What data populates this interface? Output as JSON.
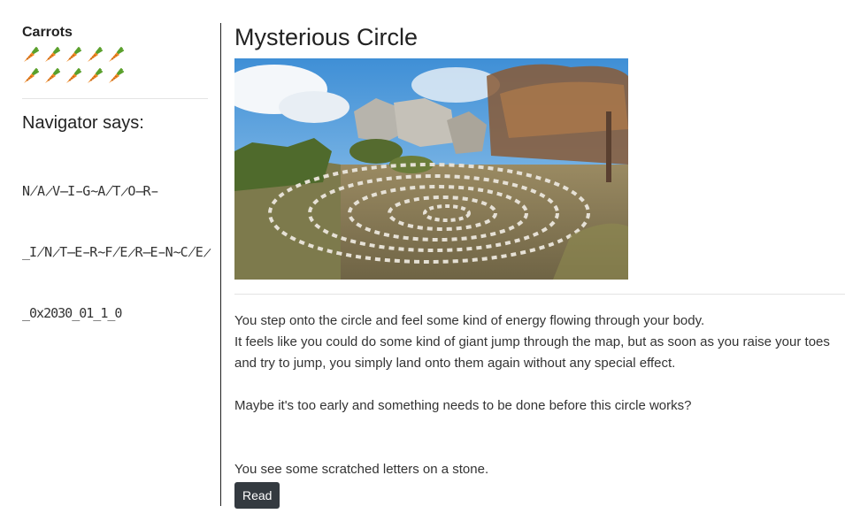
{
  "sidebar": {
    "carrots_title": "Carrots",
    "carrot_count": 10,
    "carrot_icon": "carrot-icon",
    "navigator_title": "Navigator says:",
    "navigator_lines": [
      "N̸A̷V̶I̵G̴A̸T̷O̶R̵",
      "_I̸N̷T̶E̵R̴F̸E̷R̶E̵N̴C̸E̷",
      "_0x2030_01_1_0"
    ]
  },
  "main": {
    "title": "Mysterious Circle",
    "image_alt": "stone spiral circle",
    "paragraph1_line1": "You step onto the circle and feel some kind of energy flowing through your body.",
    "paragraph1_line2": "It feels like you could do some kind of giant jump through the map, but as soon as you raise your toes and try to jump, you simply land onto them again without any special effect.",
    "paragraph2": "Maybe it's too early and something needs to be done before this circle works?",
    "paragraph3": "You see some scratched letters on a stone.",
    "read_button": "Read"
  },
  "colors": {
    "divider": "#222222",
    "button_bg": "#343a40",
    "button_text": "#ffffff",
    "carrot_orange": "#f08a24",
    "carrot_green": "#5aa02c"
  }
}
